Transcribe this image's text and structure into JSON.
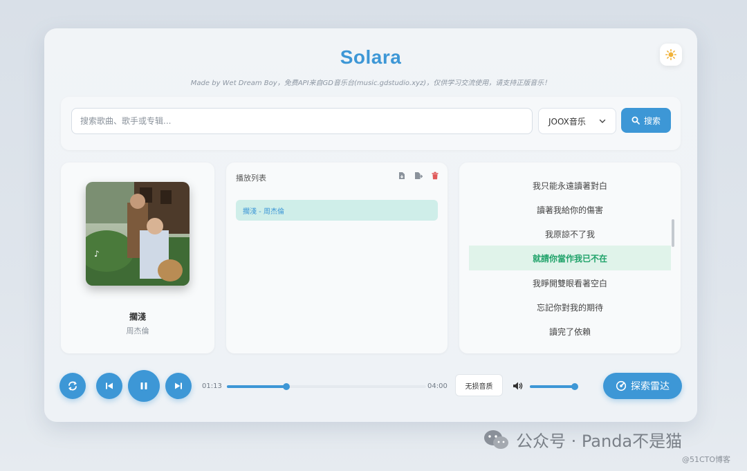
{
  "app": {
    "title": "Solara",
    "subtitle": "Made by Wet Dream Boy，免费API来自GD音乐台(music.gdstudio.xyz)，仅供学习交流使用，请支持正版音乐！",
    "theme_icon": "sun-icon"
  },
  "search": {
    "placeholder": "搜索歌曲、歌手或专辑...",
    "value": "",
    "source": "JOOX音乐",
    "button_label": "搜索"
  },
  "now_playing": {
    "title": "擱淺",
    "artist": "周杰倫"
  },
  "playlist": {
    "header": "播放列表",
    "tools": [
      "import-icon",
      "export-icon",
      "trash-icon"
    ],
    "items": [
      {
        "label": "擱淺 - 周杰倫",
        "active": true
      }
    ]
  },
  "lyrics": {
    "lines": [
      "我只能永遠讀著對白",
      "讀著我給你的傷害",
      "我原諒不了我",
      "就請你當作我已不在",
      "我睜開雙眼看著空白",
      "忘記你對我的期待",
      "讀完了依賴"
    ],
    "active_index": 3
  },
  "player": {
    "current_time": "01:13",
    "total_time": "04:00",
    "progress_fraction": 0.3,
    "quality_label": "无损音质",
    "volume_fraction": 0.95,
    "radar_label": "探索雷达"
  },
  "watermark": {
    "main": "公众号 · Panda不是猫",
    "sub": "@51CTO博客"
  },
  "colors": {
    "accent": "#3d97d6",
    "active_lyric": "#1fa269",
    "danger": "#e05b5b"
  }
}
